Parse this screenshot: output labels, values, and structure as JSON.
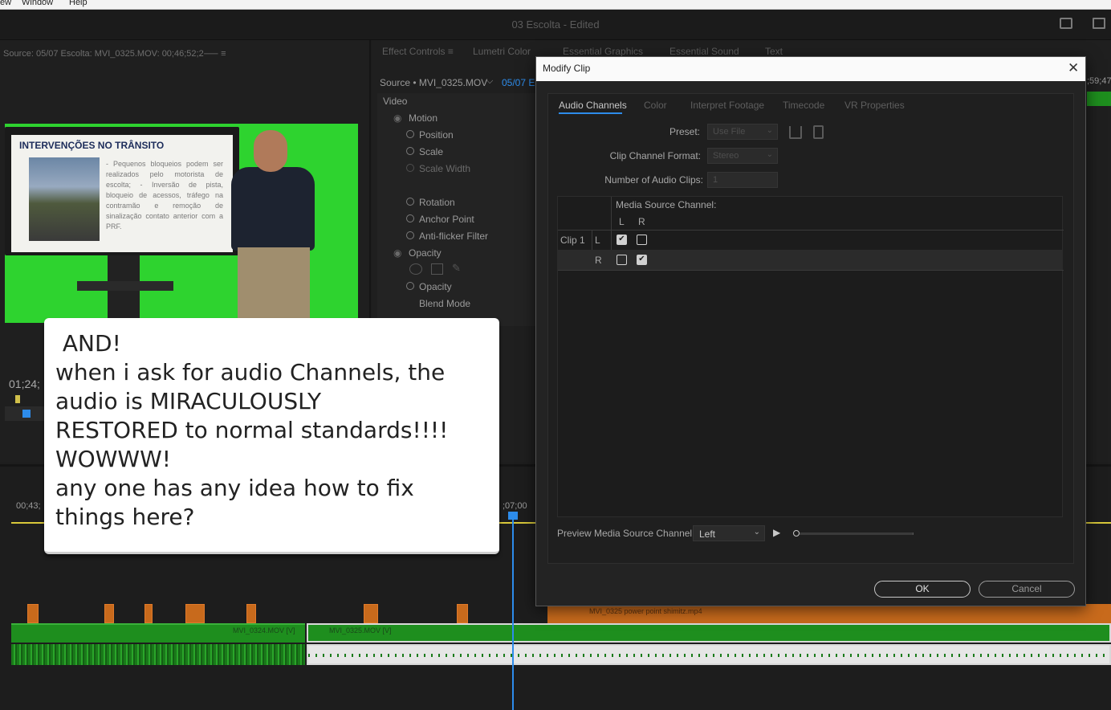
{
  "menu": {
    "items": [
      "ew",
      "Window",
      "Help"
    ]
  },
  "app": {
    "title": "03 Escolta - Edited"
  },
  "source_monitor": {
    "header": "Source: 05/07 Escolta: MVI_0325.MOV: 00;46;52;2⸺ ≡",
    "timecode": "01;24;",
    "frame": {
      "slide_title": "INTERVENÇÕES NO TRÂNSITO",
      "slide_text": "- Pequenos bloqueios podem ser realizados pelo motorista de escolta; - Inversão de pista, bloqueio de acessos, tráfego na contramão e remoção de sinalização contato anterior com a PRF."
    }
  },
  "panel_tabs": {
    "effect_controls": "Effect Controls ≡",
    "lumetri": "Lumetri Color",
    "essential_graphics": "Essential Graphics",
    "essential_sound": "Essential Sound",
    "text": "Text"
  },
  "effect_controls": {
    "source": "Source • MVI_0325.MOV",
    "source_dropdown": "⌵",
    "sequence_partial": "05/07 E",
    "right_time": ";59;47",
    "video_label": "Video",
    "motion": "Motion",
    "position": "Position",
    "scale": "Scale",
    "scale_width": "Scale Width",
    "rotation": "Rotation",
    "anchor": "Anchor Point",
    "anti_flicker": "Anti-flicker Filter",
    "opacity_group": "Opacity",
    "opacity": "Opacity",
    "blend": "Blend Mode"
  },
  "timeline": {
    "time_left": "00;43;",
    "time_mid": ";07;00",
    "orange_clip_label": "MVI_0325 power point shimitz.mp4",
    "video_clip_1": "MVI_0324.MOV [V]",
    "video_clip_2": "MVI_0325.MOV [V]"
  },
  "modal": {
    "title": "Modify Clip",
    "close": "✕",
    "tabs": [
      "Audio Channels",
      "Color",
      "Interpret Footage",
      "Timecode",
      "VR Properties"
    ],
    "preset_label": "Preset:",
    "preset_value": "Use File",
    "format_label": "Clip Channel Format:",
    "format_value": "Stereo",
    "num_clips_label": "Number of Audio Clips:",
    "num_clips_value": "1",
    "media_source_channel": "Media Source Channel:",
    "col_l": "L",
    "col_r": "R",
    "clip_label": "Clip 1",
    "rows": [
      {
        "ch": "L",
        "l_checked": true,
        "r_checked": false
      },
      {
        "ch": "R",
        "l_checked": false,
        "r_checked": true
      }
    ],
    "preview_label": "Preview Media Source Channel:",
    "preview_value": "Left",
    "play": "▶",
    "ok": "OK",
    "cancel": "Cancel"
  },
  "callout": {
    "text": " AND!\nwhen i ask for audio Channels, the\naudio is MIRACULOUSLY\nRESTORED to normal standards!!!!\nWOWWW!\nany one has any idea how to fix\nthings here?"
  },
  "colors": {
    "accent": "#2d8ceb",
    "green_screen": "#2ed32f",
    "video_clip": "#1e8e1e",
    "orange_clip": "#c86a1c",
    "work_area": "#d8c83a"
  }
}
